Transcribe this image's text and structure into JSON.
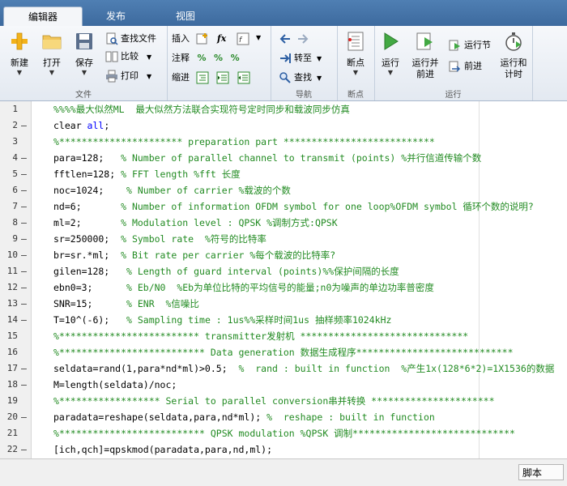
{
  "tabs": [
    {
      "label": "编辑器",
      "active": true
    },
    {
      "label": "发布",
      "active": false
    },
    {
      "label": "视图",
      "active": false
    }
  ],
  "ribbon": {
    "file": {
      "label": "文件",
      "new": "新建",
      "open": "打开",
      "save": "保存",
      "find_files": "查找文件",
      "compare": "比较",
      "print": "打印"
    },
    "edit": {
      "insert": "插入",
      "comment": "注释",
      "indent": "缩进",
      "fx": "fx"
    },
    "nav": {
      "label": "导航",
      "goto": "转至",
      "find": "查找"
    },
    "breakpoints": {
      "label": "断点",
      "breakpoint": "断点"
    },
    "run": {
      "label": "运行",
      "run": "运行",
      "run_advance_1": "运行并",
      "run_advance_2": "前进",
      "run_section": "运行节",
      "advance": "前进",
      "run_time_1": "运行和",
      "run_time_2": "计时"
    }
  },
  "editor": {
    "lines": [
      {
        "n": "1",
        "dash": "",
        "segs": [
          [
            "c",
            "%%%%最大似然ML  最大似然方法联合实现符号定时同步和载波同步仿真"
          ]
        ]
      },
      {
        "n": "2",
        "dash": "–",
        "segs": [
          [
            "t",
            "clear "
          ],
          [
            "k",
            "all"
          ],
          [
            "t",
            ";"
          ]
        ]
      },
      {
        "n": "3",
        "dash": "",
        "segs": [
          [
            "c",
            "%********************** preparation part ***************************"
          ]
        ]
      },
      {
        "n": "4",
        "dash": "–",
        "segs": [
          [
            "t",
            "para=128;   "
          ],
          [
            "c",
            "% Number of parallel channel to transmit (points) %并行信道传输个数"
          ]
        ]
      },
      {
        "n": "5",
        "dash": "–",
        "segs": [
          [
            "t",
            "fftlen=128; "
          ],
          [
            "c",
            "% FFT length %fft 长度"
          ]
        ]
      },
      {
        "n": "6",
        "dash": "–",
        "segs": [
          [
            "t",
            "noc=1024;    "
          ],
          [
            "c",
            "% Number of carrier %载波的个数"
          ]
        ]
      },
      {
        "n": "7",
        "dash": "–",
        "segs": [
          [
            "t",
            "nd=6;       "
          ],
          [
            "c",
            "% Number of information OFDM symbol for one loop%OFDM symbol 循环个数的说明?"
          ]
        ]
      },
      {
        "n": "8",
        "dash": "–",
        "segs": [
          [
            "t",
            "ml=2;       "
          ],
          [
            "c",
            "% Modulation level : QPSK %调制方式:QPSK"
          ]
        ]
      },
      {
        "n": "9",
        "dash": "–",
        "segs": [
          [
            "t",
            "sr=250000;  "
          ],
          [
            "c",
            "% Symbol rate  %符号的比特率"
          ]
        ]
      },
      {
        "n": "10",
        "dash": "–",
        "segs": [
          [
            "t",
            "br=sr.*ml;  "
          ],
          [
            "c",
            "% Bit rate per carrier %每个载波的比特率?"
          ]
        ]
      },
      {
        "n": "11",
        "dash": "–",
        "segs": [
          [
            "t",
            "gilen=128;   "
          ],
          [
            "c",
            "% Length of guard interval (points)%%保护间隔的长度"
          ]
        ]
      },
      {
        "n": "12",
        "dash": "–",
        "segs": [
          [
            "t",
            "ebn0=3;      "
          ],
          [
            "c",
            "% Eb/N0  %Eb为单位比特的平均信号的能量;n0为噪声的单边功率普密度"
          ]
        ]
      },
      {
        "n": "13",
        "dash": "–",
        "segs": [
          [
            "t",
            "SNR=15;      "
          ],
          [
            "c",
            "% ENR  %信噪比"
          ]
        ]
      },
      {
        "n": "14",
        "dash": "–",
        "segs": [
          [
            "t",
            "T=10^(-6);   "
          ],
          [
            "c",
            "% Sampling time : 1us%%采样时间1us 抽样频率1024kHz"
          ]
        ]
      },
      {
        "n": "15",
        "dash": "",
        "segs": [
          [
            "c",
            "%************************* transmitter发射机 ******************************"
          ]
        ]
      },
      {
        "n": "16",
        "dash": "",
        "segs": [
          [
            "c",
            "%************************** Data generation 数据生成程序****************************"
          ]
        ]
      },
      {
        "n": "17",
        "dash": "–",
        "segs": [
          [
            "t",
            "seldata=rand(1,para*nd*ml)>0.5;  "
          ],
          [
            "c",
            "%  rand : built in function  %产生1x(128*6*2)=1X1536的数据"
          ]
        ]
      },
      {
        "n": "18",
        "dash": "–",
        "segs": [
          [
            "t",
            "M=length(seldata)/noc;"
          ]
        ]
      },
      {
        "n": "19",
        "dash": "",
        "segs": [
          [
            "c",
            "%****************** Serial to parallel conversion串并转换 **********************"
          ]
        ]
      },
      {
        "n": "20",
        "dash": "–",
        "segs": [
          [
            "t",
            "paradata=reshape(seldata,para,nd*ml); "
          ],
          [
            "c",
            "%  reshape : built in function"
          ]
        ]
      },
      {
        "n": "21",
        "dash": "",
        "segs": [
          [
            "c",
            "%************************** QPSK modulation %QPSK 调制*****************************"
          ]
        ]
      },
      {
        "n": "22",
        "dash": "–",
        "segs": [
          [
            "t",
            "[ich,qch]=qpskmod(paradata,para,nd,ml);"
          ]
        ]
      }
    ]
  },
  "statusbar": {
    "type": "脚本"
  },
  "colors": {
    "comment": "#228b22",
    "keyword": "#0000ff",
    "tabstrip": "#4f7fb3"
  }
}
